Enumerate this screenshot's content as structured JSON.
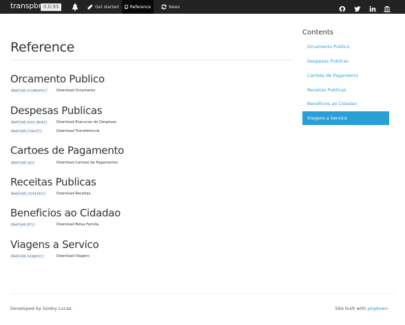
{
  "navbar": {
    "brand": "transpbrr",
    "version": "0.0.93",
    "items": [
      {
        "label": "Get started",
        "icon": "rocket-icon"
      },
      {
        "label": "Reference",
        "icon": "file-icon"
      },
      {
        "label": "News",
        "icon": "refresh-icon"
      }
    ],
    "right_icons": [
      "github-icon",
      "twitter-icon",
      "linkedin-icon",
      "bank-icon"
    ]
  },
  "main": {
    "title": "Reference",
    "sections": [
      {
        "title": "Orcamento Publico",
        "rows": [
          {
            "code": "download_orcamento()",
            "desc": "Download Orcamento"
          }
        ]
      },
      {
        "title": "Despesas Publicas",
        "rows": [
          {
            "code": "download_exec_desp()",
            "desc": "Download Execucao de Despesas"
          },
          {
            "code": "download_transf()",
            "desc": "Download Transferencia"
          }
        ]
      },
      {
        "title": "Cartoes de Pagamento",
        "rows": [
          {
            "code": "download_cp()",
            "desc": "Download Cartoes de Pagamentos"
          }
        ]
      },
      {
        "title": "Receitas Publicas",
        "rows": [
          {
            "code": "download_receitas()",
            "desc": "Download Receitas"
          }
        ]
      },
      {
        "title": "Beneficios ao Cidadao",
        "rows": [
          {
            "code": "download_bf()",
            "desc": "Download Bolsa Familia"
          }
        ]
      },
      {
        "title": "Viagens a Servico",
        "rows": [
          {
            "code": "download_viagens()",
            "desc": "Download Viagens"
          }
        ]
      }
    ]
  },
  "sidebar": {
    "title": "Contents",
    "items": [
      "Orcamento Publico",
      "Despesas Publicas",
      "Cartoes de Pagamento",
      "Receitas Publicas",
      "Beneficios ao Cidadao",
      "Viagens a Servico"
    ],
    "active_index": 5
  },
  "footer": {
    "left": "Developed by Godoy Lucas.",
    "right_prefix": "Site built with ",
    "right_link": "pkgdown",
    "right_suffix": "."
  },
  "colors": {
    "navbar_bg": "#222222",
    "accent": "#2a9fd6",
    "text": "#333333"
  }
}
